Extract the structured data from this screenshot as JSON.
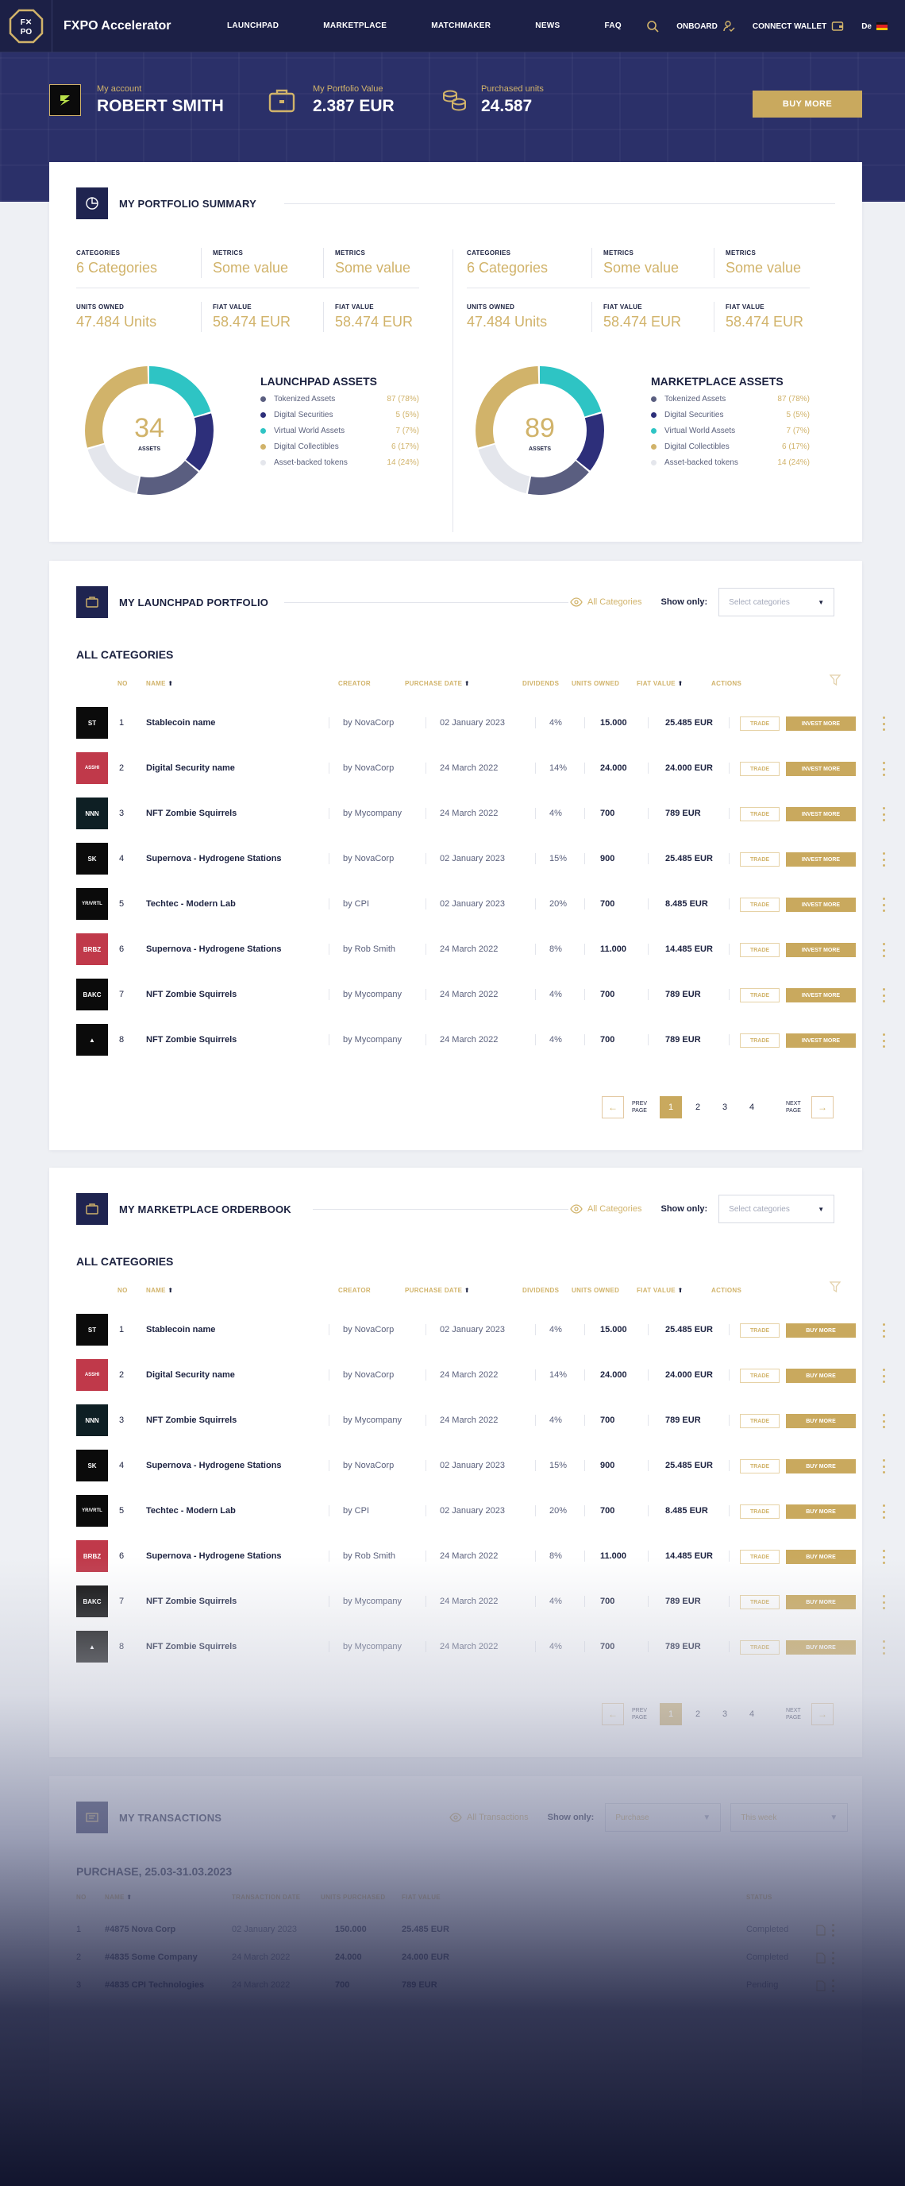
{
  "header": {
    "logo_text": "FXPO",
    "brand": "FXPO Accelerator",
    "nav": [
      "LAUNCHPAD",
      "MARKETPLACE",
      "MATCHMAKER",
      "NEWS",
      "FAQ"
    ],
    "onboard": "ONBOARD",
    "connect_wallet": "CONNECT WALLET",
    "language": "De"
  },
  "hero": {
    "account_label": "My account",
    "account_name": "ROBERT SMITH",
    "portfolio_label": "My Portfolio Value",
    "portfolio_value": "2.387 EUR",
    "units_label": "Purchased units",
    "units_value": "24.587",
    "buy_more": "BUY MORE"
  },
  "summary": {
    "title": "MY PORTFOLIO SUMMARY",
    "panels": [
      {
        "metrics": [
          {
            "label": "CATEGORIES",
            "value": "6 Categories"
          },
          {
            "label": "METRICS",
            "value": "Some value"
          },
          {
            "label": "METRICS",
            "value": "Some value"
          },
          {
            "label": "UNITS OWNED",
            "value": "47.484 Units"
          },
          {
            "label": "FIAT VALUE",
            "value": "58.474 EUR"
          },
          {
            "label": "FIAT VALUE",
            "value": "58.474 EUR"
          }
        ],
        "donut_number": "34",
        "donut_label": "ASSETS",
        "legend_title": "LAUNCHPAD ASSETS",
        "legend": [
          {
            "name": "Tokenized Assets",
            "value": "87 (78%)",
            "color": "#5a5e80"
          },
          {
            "name": "Digital Securities",
            "value": "5 (5%)",
            "color": "#2d2f7a"
          },
          {
            "name": "Virtual World Assets",
            "value": "7 (7%)",
            "color": "#2ec4c4"
          },
          {
            "name": "Digital Collectibles",
            "value": "6 (17%)",
            "color": "#d1b36a"
          },
          {
            "name": "Asset-backed tokens",
            "value": "14 (24%)",
            "color": "#e4e6ec"
          }
        ]
      },
      {
        "metrics": [
          {
            "label": "CATEGORIES",
            "value": "6 Categories"
          },
          {
            "label": "METRICS",
            "value": "Some value"
          },
          {
            "label": "METRICS",
            "value": "Some value"
          },
          {
            "label": "UNITS OWNED",
            "value": "47.484 Units"
          },
          {
            "label": "FIAT VALUE",
            "value": "58.474 EUR"
          },
          {
            "label": "FIAT VALUE",
            "value": "58.474 EUR"
          }
        ],
        "donut_number": "89",
        "donut_label": "ASSETS",
        "legend_title": "MARKETPLACE ASSETS",
        "legend": [
          {
            "name": "Tokenized Assets",
            "value": "87 (78%)",
            "color": "#5a5e80"
          },
          {
            "name": "Digital Securities",
            "value": "5 (5%)",
            "color": "#2d2f7a"
          },
          {
            "name": "Virtual World Assets",
            "value": "7 (7%)",
            "color": "#2ec4c4"
          },
          {
            "name": "Digital Collectibles",
            "value": "6 (17%)",
            "color": "#d1b36a"
          },
          {
            "name": "Asset-backed tokens",
            "value": "14 (24%)",
            "color": "#e4e6ec"
          }
        ]
      }
    ]
  },
  "launchpad": {
    "title": "MY LAUNCHPAD PORTFOLIO",
    "all_categories_link": "All Categories",
    "show_only": "Show only:",
    "select_placeholder": "Select categories",
    "section_label": "ALL CATEGORIES",
    "columns": [
      "NO",
      "NAME",
      "CREATOR",
      "PURCHASE DATE",
      "DIVIDENDS",
      "UNITS OWNED",
      "FIAT VALUE",
      "ACTIONS"
    ],
    "trade_label": "TRADE",
    "action_label": "INVEST MORE",
    "pager": {
      "prev": "PREV PAGE",
      "next": "NEXT PAGE",
      "pages": [
        "1",
        "2",
        "3",
        "4"
      ]
    }
  },
  "orderbook": {
    "title": "MY MARKETPLACE ORDERBOOK",
    "all_categories_link": "All Categories",
    "show_only": "Show only:",
    "select_placeholder": "Select categories",
    "section_label": "ALL CATEGORIES",
    "columns": [
      "NO",
      "NAME",
      "CREATOR",
      "PURCHASE DATE",
      "DIVIDENDS",
      "UNITS OWNED",
      "FIAT VALUE",
      "ACTIONS"
    ],
    "trade_label": "TRADE",
    "action_label": "BUY MORE",
    "pager": {
      "prev": "PREV PAGE",
      "next": "NEXT PAGE",
      "pages": [
        "1",
        "2",
        "3",
        "4"
      ]
    }
  },
  "rows": [
    {
      "no": "1",
      "icon": "ST",
      "icon_bg": "#0b0b0b",
      "name": "Stablecoin name",
      "creator": "by NovaCorp",
      "date": "02 January 2023",
      "div": "4%",
      "units": "15.000",
      "fiat": "25.485 EUR"
    },
    {
      "no": "2",
      "icon": "ASSHI",
      "icon_bg": "#c0394a",
      "name": "Digital Security  name",
      "creator": "by NovaCorp",
      "date": "24 March 2022",
      "div": "14%",
      "units": "24.000",
      "fiat": "24.000 EUR"
    },
    {
      "no": "3",
      "icon": "NNN",
      "icon_bg": "#0e1f24",
      "name": "NFT Zombie Squirrels",
      "creator": "by  Mycompany",
      "date": "24 March 2022",
      "div": "4%",
      "units": "700",
      "fiat": "789 EUR"
    },
    {
      "no": "4",
      "icon": "SK",
      "icon_bg": "#0b0b0b",
      "name": "Supernova - Hydrogene Stations",
      "creator": "by NovaCorp",
      "date": "02 January 2023",
      "div": "15%",
      "units": "900",
      "fiat": "25.485 EUR"
    },
    {
      "no": "5",
      "icon": "YR/VRTL",
      "icon_bg": "#0b0b0b",
      "name": "Techtec - Modern Lab",
      "creator": "by CPI",
      "date": "02 January 2023",
      "div": "20%",
      "units": "700",
      "fiat": "8.485 EUR"
    },
    {
      "no": "6",
      "icon": "BRBZ",
      "icon_bg": "#c0394a",
      "name": "Supernova - Hydrogene Stations",
      "creator": "by Rob Smith",
      "date": "24 March 2022",
      "div": "8%",
      "units": "11.000",
      "fiat": "14.485 EUR"
    },
    {
      "no": "7",
      "icon": "BAKC",
      "icon_bg": "#0b0b0b",
      "name": "NFT Zombie Squirrels",
      "creator": "by  Mycompany",
      "date": "24 March 2022",
      "div": "4%",
      "units": "700",
      "fiat": "789 EUR"
    },
    {
      "no": "8",
      "icon": "▲",
      "icon_bg": "#0b0b0b",
      "name": "NFT Zombie Squirrels",
      "creator": "by  Mycompany",
      "date": "24 March 2022",
      "div": "4%",
      "units": "700",
      "fiat": "789 EUR"
    }
  ],
  "transactions": {
    "title": "MY TRANSACTIONS",
    "all_link": "All Transactions",
    "show_only": "Show only:",
    "filter1": "Purchase",
    "filter2": "This week",
    "period": "PURCHASE,  25.03-31.03.2023",
    "columns": [
      "NO",
      "NAME",
      "TRANSACTION DATE",
      "UNITS PURCHASED",
      "FIAT VALUE",
      "STATUS"
    ],
    "rows": [
      {
        "no": "1",
        "name": "#4875 Nova Corp",
        "date": "02 January 2023",
        "units": "150.000",
        "fiat": "25.485 EUR",
        "status": "Completed"
      },
      {
        "no": "2",
        "name": "#4835 Some Company",
        "date": "24 March 2022",
        "units": "24.000",
        "fiat": "24.000 EUR",
        "status": "Completed"
      },
      {
        "no": "3",
        "name": "#4835 CPI Technologies",
        "date": "24 March 2022",
        "units": "700",
        "fiat": "789 EUR",
        "status": "Pending"
      }
    ]
  },
  "colors": {
    "navy": "#1c2046",
    "gold": "#c9a95e",
    "gold_text": "#d1b36a"
  }
}
